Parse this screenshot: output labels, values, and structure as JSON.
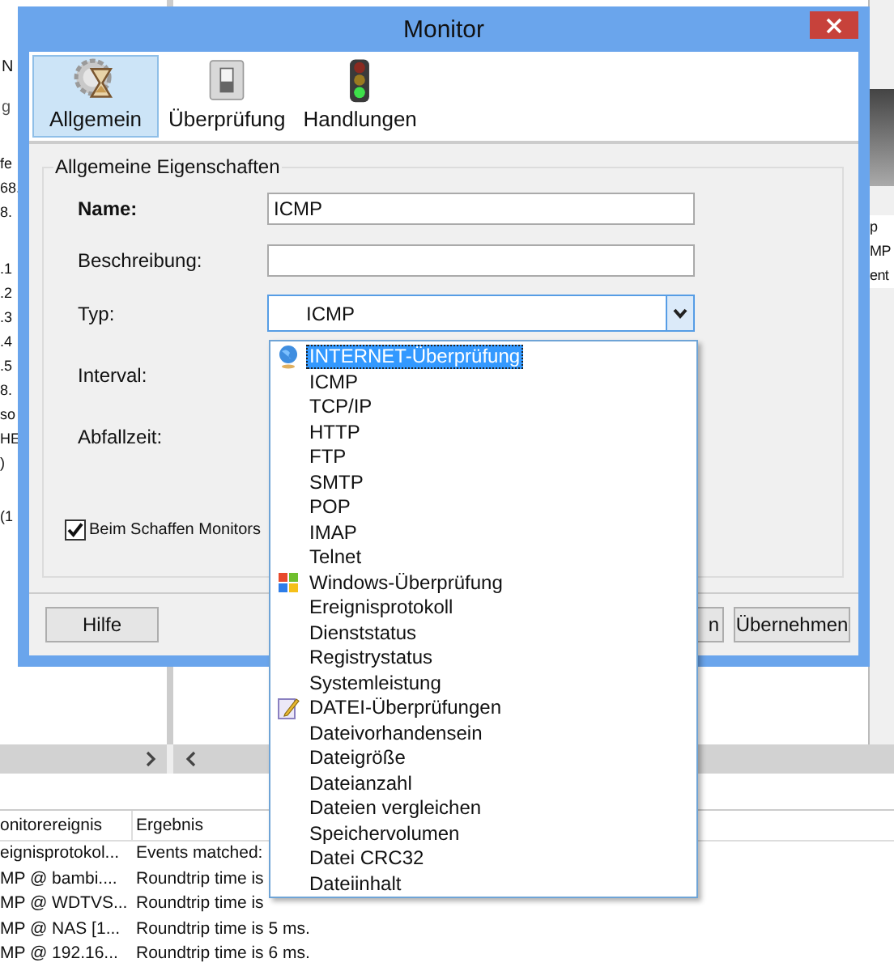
{
  "background": {
    "left_pane": {
      "header": [
        "N",
        "g"
      ],
      "blocks": [
        [
          "fe",
          "68.",
          "8."
        ],
        [
          ".1",
          ".2",
          ".3",
          ".4",
          ".5",
          "8.",
          "so",
          "HE",
          ")"
        ],
        [
          "(1"
        ]
      ]
    },
    "right_pane": {
      "lines": [
        "p",
        "MP",
        "ent"
      ]
    },
    "table": {
      "columns": [
        "onitorereignis",
        "Ergebnis"
      ],
      "rows": [
        [
          "eignisprotokol...",
          "Events matched:"
        ],
        [
          "MP @ bambi....",
          "Roundtrip time is"
        ],
        [
          "MP @ WDTVS...",
          "Roundtrip time is"
        ],
        [
          "MP @ NAS [1...",
          "Roundtrip time is 5 ms."
        ],
        [
          "MP @ 192.16...",
          "Roundtrip time is 6 ms."
        ]
      ]
    }
  },
  "window": {
    "title": "Monitor"
  },
  "tabs": [
    {
      "label": "Allgemein",
      "kind": "general",
      "selected": true
    },
    {
      "label": "Überprüfung",
      "kind": "check",
      "selected": false
    },
    {
      "label": "Handlungen",
      "kind": "actions",
      "selected": false
    }
  ],
  "group": {
    "title": "Allgemeine Eigenschaften",
    "fields": [
      {
        "label": "Name:",
        "kind": "text",
        "value": "ICMP"
      },
      {
        "label": "Beschreibung:",
        "kind": "text"
      },
      {
        "label": "Typ:",
        "kind": "combo",
        "value": "ICMP"
      },
      {
        "label": "Interval:",
        "kind": "hidden"
      },
      {
        "label": "Abfallzeit:",
        "kind": "hidden"
      }
    ],
    "checkbox": {
      "label": "Beim Schaffen Monitors",
      "checked": true
    }
  },
  "buttons": [
    {
      "label": "Hilfe",
      "kind": "left"
    },
    {
      "label": "n",
      "kind": "cut"
    },
    {
      "label": "Übernehmen",
      "kind": "right"
    }
  ],
  "dropdown": {
    "items": [
      {
        "label": "INTERNET-Überprüfung",
        "kind": "internet",
        "selected": true
      },
      {
        "label": "ICMP",
        "kind": "item",
        "selected": false
      },
      {
        "label": "TCP/IP",
        "kind": "item",
        "selected": false
      },
      {
        "label": "HTTP",
        "kind": "item",
        "selected": false
      },
      {
        "label": "FTP",
        "kind": "item",
        "selected": false
      },
      {
        "label": "SMTP",
        "kind": "item",
        "selected": false
      },
      {
        "label": "POP",
        "kind": "item",
        "selected": false
      },
      {
        "label": "IMAP",
        "kind": "item",
        "selected": false
      },
      {
        "label": "Telnet",
        "kind": "item",
        "selected": false
      },
      {
        "label": "Windows-Überprüfung",
        "kind": "windows",
        "selected": false
      },
      {
        "label": "Ereignisprotokoll",
        "kind": "item",
        "selected": false
      },
      {
        "label": "Dienststatus",
        "kind": "item",
        "selected": false
      },
      {
        "label": "Registrystatus",
        "kind": "item",
        "selected": false
      },
      {
        "label": "Systemleistung",
        "kind": "item",
        "selected": false
      },
      {
        "label": "DATEI-Überprüfungen",
        "kind": "file",
        "selected": false
      },
      {
        "label": "Dateivorhandensein",
        "kind": "item",
        "selected": false
      },
      {
        "label": "Dateigröße",
        "kind": "item",
        "selected": false
      },
      {
        "label": "Dateianzahl",
        "kind": "item",
        "selected": false
      },
      {
        "label": "Dateien vergleichen",
        "kind": "item",
        "selected": false
      },
      {
        "label": "Speichervolumen",
        "kind": "item",
        "selected": false
      },
      {
        "label": "Datei CRC32",
        "kind": "item",
        "selected": false
      },
      {
        "label": "Dateiinhalt",
        "kind": "item",
        "selected": false
      }
    ]
  }
}
